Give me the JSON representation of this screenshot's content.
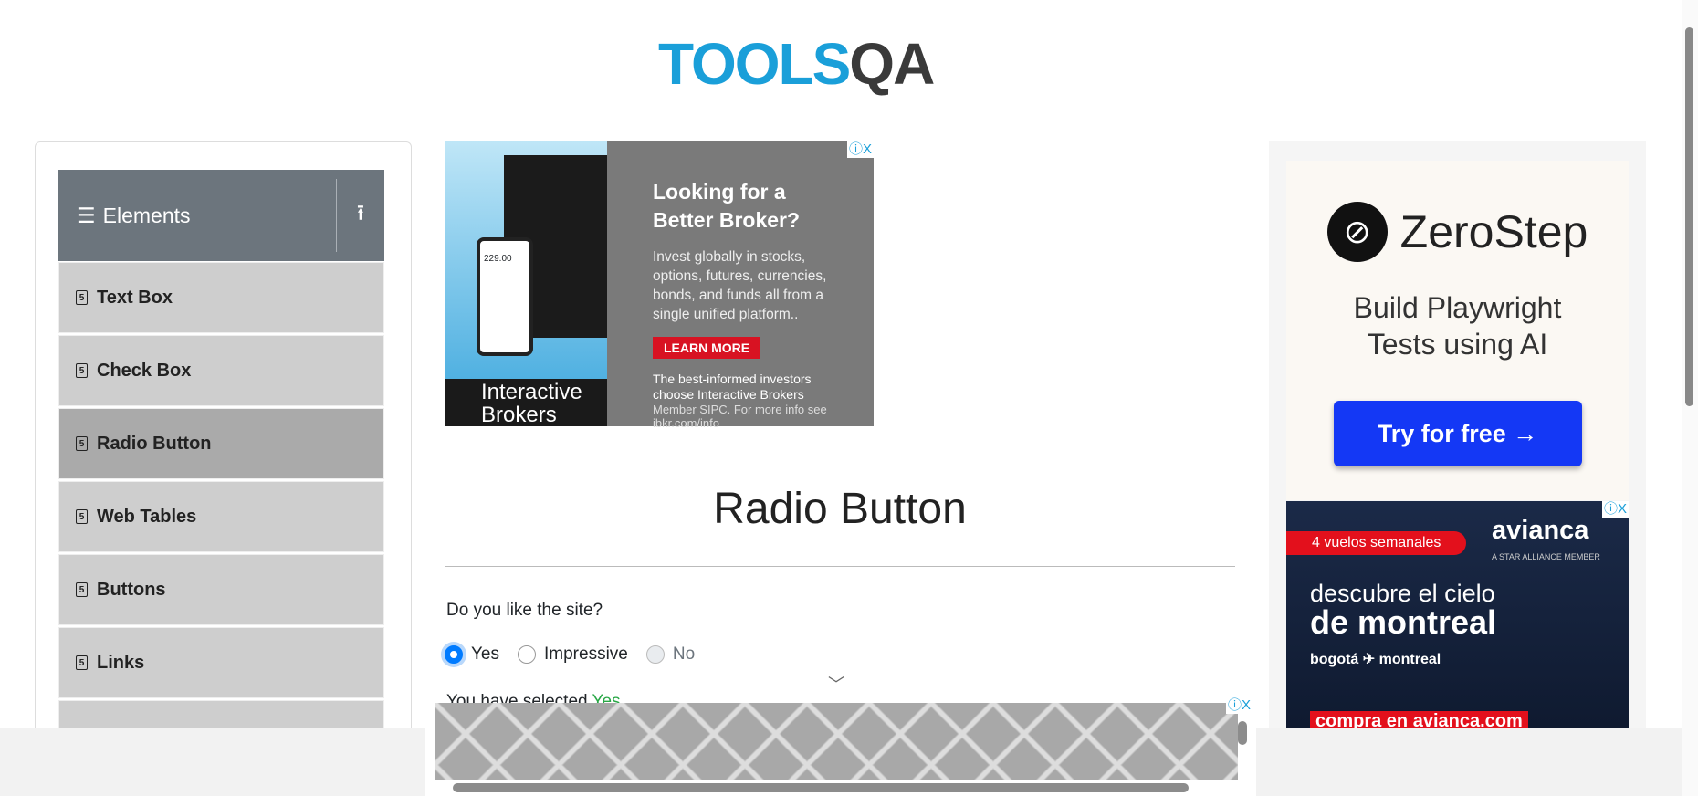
{
  "logo": {
    "part1": "TOOLS",
    "part2": "QA"
  },
  "sidebar": {
    "group": "Elements",
    "items": [
      {
        "label": "Text Box"
      },
      {
        "label": "Check Box"
      },
      {
        "label": "Radio Button",
        "active": true
      },
      {
        "label": "Web Tables"
      },
      {
        "label": "Buttons"
      },
      {
        "label": "Links"
      }
    ]
  },
  "ad_ibkr": {
    "heading1": "Looking for a",
    "heading2": "Better Broker?",
    "body": "Invest globally in stocks, options, futures, currencies, bonds, and funds all from a single unified platform..",
    "cta": "LEARN MORE",
    "tagline": "The best-informed investors choose Interactive Brokers",
    "disclaimer": "Member SIPC. For more info see ibkr.com/info",
    "brand1": "Interactive",
    "brand2": "Brokers",
    "phone_value": "229.00"
  },
  "main": {
    "title": "Radio Button",
    "question": "Do you like the site?",
    "options": [
      {
        "label": "Yes",
        "checked": true
      },
      {
        "label": "Impressive"
      },
      {
        "label": "No",
        "disabled": true
      }
    ],
    "result_prefix": "You have selected ",
    "result_value": "Yes"
  },
  "ad_zerostep": {
    "brand": "ZeroStep",
    "tagline1": "Build Playwright",
    "tagline2": "Tests using AI",
    "cta": "Try for free →"
  },
  "ad_avianca": {
    "pill": "4 vuelos semanales",
    "brand": "avianca",
    "alliance": "A STAR ALLIANCE MEMBER",
    "line1": "descubre el cielo",
    "line2": "de montreal",
    "route": "bogotá ✈ montreal",
    "cta": "compra en avianca.com"
  },
  "ad_controls": {
    "info": "ⓘ",
    "close": "X"
  },
  "colors": {
    "accent": "#007bff",
    "selected": "#28a745",
    "sidebar_header": "#6c757d"
  }
}
